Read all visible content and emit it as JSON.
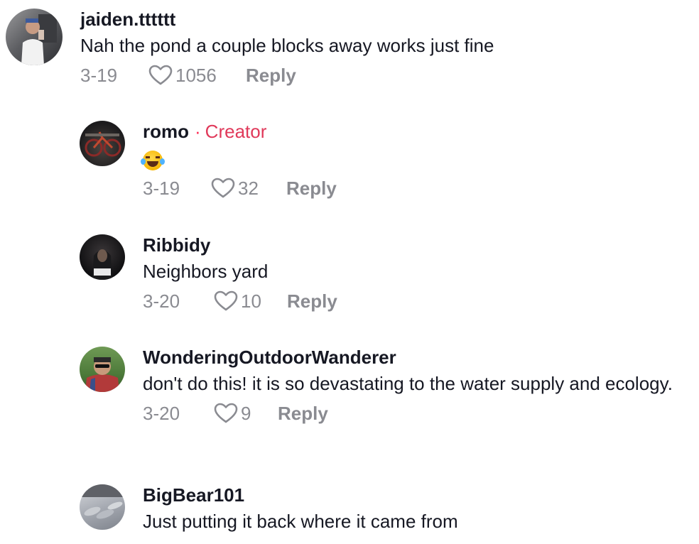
{
  "comments": [
    {
      "username": "jaiden.tttttt",
      "text": "Nah the pond a couple blocks away works just fine",
      "date": "3-19",
      "likes": "1056",
      "reply": "Reply",
      "avatar_icon": "user-avatar-photo"
    },
    {
      "username": "romo",
      "badge": "Creator",
      "text": "",
      "emoji": "face-with-tears-of-joy",
      "date": "3-19",
      "likes": "32",
      "reply": "Reply",
      "avatar_icon": "user-avatar-photo"
    },
    {
      "username": "Ribbidy",
      "text": "Neighbors yard",
      "date": "3-20",
      "likes": "10",
      "reply": "Reply",
      "avatar_icon": "user-avatar-photo"
    },
    {
      "username": "WonderingOutdoorWanderer",
      "text": "don't do this! it is so devastating to the water supply and ecology.",
      "date": "3-20",
      "likes": "9",
      "reply": "Reply",
      "avatar_icon": "user-avatar-photo"
    },
    {
      "username": "BigBear101",
      "text": "Just putting it back where it came from",
      "avatar_icon": "user-avatar-photo"
    }
  ],
  "colors": {
    "creator_badge": "#e0395a",
    "meta_gray": "#8a8b91",
    "text": "#161823"
  }
}
